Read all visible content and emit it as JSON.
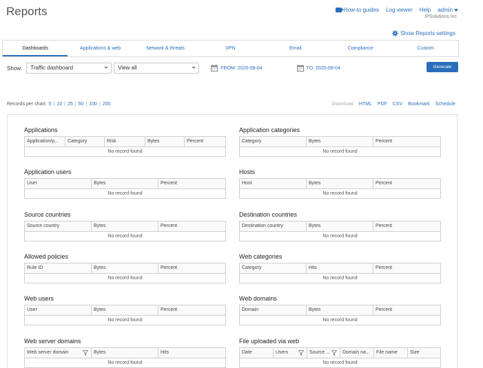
{
  "page": {
    "title": "Reports"
  },
  "topnav": {
    "how_to": "How-to guides",
    "log_viewer": "Log viewer",
    "help": "Help",
    "user": "admin",
    "org": "IPSolutions Inc"
  },
  "settings_link": "Show Reports settings",
  "tabs": [
    {
      "label": "Dashboards",
      "active": true
    },
    {
      "label": "Applications & web"
    },
    {
      "label": "Network & threats"
    },
    {
      "label": "VPN"
    },
    {
      "label": "Email"
    },
    {
      "label": "Compliance"
    },
    {
      "label": "Custom"
    }
  ],
  "filters": {
    "show_label": "Show:",
    "dashboard_select": "Traffic dashboard",
    "view_select": "View all",
    "from_date": "FROM: 2020-08-04",
    "to_date": "TO: 2020-08-04",
    "generate": "Generate"
  },
  "records": {
    "label": "Records per chart:",
    "options": [
      "5",
      "10",
      "25",
      "50",
      "100",
      "200"
    ]
  },
  "export": {
    "download": "Download",
    "html": "HTML",
    "pdf": "PDF",
    "csv": "CSV",
    "bookmark": "Bookmark",
    "schedule": "Schedule"
  },
  "no_record": "No record found",
  "reports": [
    {
      "title": "Applications",
      "columns": [
        "Application/p...",
        "Category",
        "Risk",
        "Bytes",
        "Percent"
      ]
    },
    {
      "title": "Application categories",
      "columns": [
        "Category",
        "Bytes",
        "Percent"
      ]
    },
    {
      "title": "Application users",
      "columns": [
        "User",
        "Bytes",
        "Percent"
      ]
    },
    {
      "title": "Hosts",
      "columns": [
        "Host",
        "Bytes",
        "Percent"
      ]
    },
    {
      "title": "Source countries",
      "columns": [
        "Source country",
        "Bytes",
        "Percent"
      ]
    },
    {
      "title": "Destination countries",
      "columns": [
        "Destination country",
        "Bytes",
        "Percent"
      ]
    },
    {
      "title": "Allowed policies",
      "columns": [
        "Rule ID",
        "Bytes",
        "Percent"
      ]
    },
    {
      "title": "Web categories",
      "columns": [
        "Category",
        "Hits",
        "Percent"
      ]
    },
    {
      "title": "Web users",
      "columns": [
        "User",
        "Bytes",
        "Percent"
      ]
    },
    {
      "title": "Web domains",
      "columns": [
        "Domain",
        "Bytes",
        "Percent"
      ]
    },
    {
      "title": "Web server domains",
      "columns": [
        "Web server domain",
        "Bytes",
        "Hits"
      ]
    },
    {
      "title": "File uploaded via web",
      "columns": [
        "Date",
        "Users",
        "Source ...",
        "Domain na...",
        "File name",
        "Size"
      ]
    }
  ],
  "colors": {
    "accent": "#2a6ebb"
  }
}
